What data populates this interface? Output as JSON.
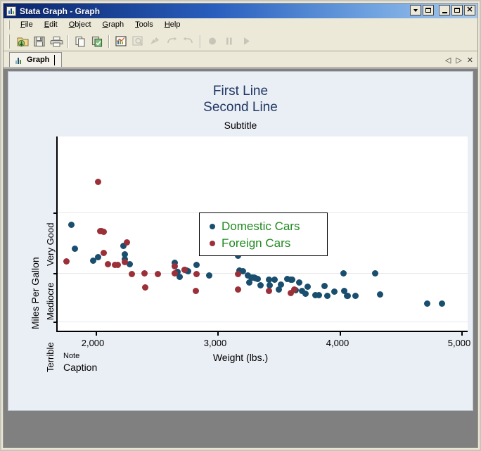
{
  "window": {
    "title": "Stata Graph - Graph",
    "title_icon": "bar-chart-icon",
    "controls": {
      "mdi_caret": "▾",
      "mdi_restore": "restore-icon",
      "minimize": "minimize-icon",
      "maximize": "maximize-icon",
      "close": "✕"
    }
  },
  "menubar": {
    "items": [
      {
        "label": "File",
        "accel": "F"
      },
      {
        "label": "Edit",
        "accel": "E"
      },
      {
        "label": "Object",
        "accel": "O"
      },
      {
        "label": "Graph",
        "accel": "G"
      },
      {
        "label": "Tools",
        "accel": "T"
      },
      {
        "label": "Help",
        "accel": "H"
      }
    ]
  },
  "toolbar": {
    "buttons": [
      {
        "name": "open-icon",
        "enabled": true
      },
      {
        "name": "save-icon",
        "enabled": true
      },
      {
        "name": "print-icon",
        "enabled": true
      },
      {
        "name": "copy-icon",
        "enabled": true
      },
      {
        "name": "paste-icon",
        "enabled": true
      },
      {
        "name": "graph-editor-icon",
        "enabled": true
      },
      {
        "name": "inspector-icon",
        "enabled": false
      },
      {
        "name": "grid-edit-icon",
        "enabled": false
      },
      {
        "name": "undo-icon",
        "enabled": false
      },
      {
        "name": "redo-icon",
        "enabled": false
      },
      {
        "name": "record-icon",
        "enabled": false
      },
      {
        "name": "pause-icon",
        "enabled": false
      },
      {
        "name": "play-icon",
        "enabled": false
      }
    ]
  },
  "tabbar": {
    "tabs": [
      {
        "label": "Graph",
        "icon": "bar-chart-icon",
        "active": true
      }
    ],
    "controls": {
      "prev": "◁",
      "next": "▷",
      "close": "✕"
    }
  },
  "chart_data": {
    "type": "scatter",
    "title": "First Line\nSecond Line",
    "title_lines": [
      "First Line",
      "Second Line"
    ],
    "subtitle": "Subtitle",
    "note": "Note",
    "caption": "Caption",
    "xlabel": "Weight (lbs.)",
    "ylabel": "Miles Per Gallon",
    "xlim": [
      1690,
      5050
    ],
    "ylim": [
      10.5,
      42.5
    ],
    "xticks": [
      2000,
      3000,
      4000,
      5000
    ],
    "xticklabels": [
      "2,000",
      "3,000",
      "4,000",
      "5,000"
    ],
    "yticks": [
      30,
      20,
      12
    ],
    "yticklabels": [
      "Very Good",
      "Mediocre",
      "Terrible"
    ],
    "grid": true,
    "legend_position": "top-center-inside",
    "colors": {
      "domestic": "#1a4e6e",
      "foreign": "#9b3039",
      "legend_text": "#1e8b1e",
      "title": "#1f3864"
    },
    "series": [
      {
        "name": "Domestic Cars",
        "color": "#1a4e6e",
        "points": [
          [
            1800,
            28
          ],
          [
            1830,
            24
          ],
          [
            1980,
            22
          ],
          [
            2020,
            22.6
          ],
          [
            2230,
            24.5
          ],
          [
            2240,
            23.1
          ],
          [
            2240,
            22.3
          ],
          [
            2280,
            21.4
          ],
          [
            2650,
            21.7
          ],
          [
            2670,
            20.2
          ],
          [
            2690,
            19.4
          ],
          [
            2730,
            20.5
          ],
          [
            2750,
            20.4
          ],
          [
            2760,
            20.3
          ],
          [
            2830,
            21.3
          ],
          [
            2930,
            19.6
          ],
          [
            3170,
            22.8
          ],
          [
            3180,
            20.4
          ],
          [
            3210,
            20.3
          ],
          [
            3250,
            19.6
          ],
          [
            3260,
            18.4
          ],
          [
            3280,
            19.2
          ],
          [
            3290,
            19.2
          ],
          [
            3300,
            19.2
          ],
          [
            3310,
            19.1
          ],
          [
            3330,
            19.0
          ],
          [
            3350,
            18.0
          ],
          [
            3420,
            18.9
          ],
          [
            3430,
            18.0
          ],
          [
            3470,
            18.9
          ],
          [
            3500,
            17.3
          ],
          [
            3520,
            18.1
          ],
          [
            3570,
            19.0
          ],
          [
            3600,
            18.9
          ],
          [
            3610,
            18.9
          ],
          [
            3640,
            17.2
          ],
          [
            3670,
            18.4
          ],
          [
            3690,
            17.0
          ],
          [
            3720,
            16.6
          ],
          [
            3740,
            17.8
          ],
          [
            3800,
            16.3
          ],
          [
            3830,
            16.3
          ],
          [
            3880,
            17.9
          ],
          [
            3900,
            16.2
          ],
          [
            3960,
            16.9
          ],
          [
            4030,
            20.0
          ],
          [
            4040,
            17.0
          ],
          [
            4060,
            16.2
          ],
          [
            4070,
            16.2
          ],
          [
            4130,
            16.2
          ],
          [
            4290,
            20.0
          ],
          [
            4330,
            16.5
          ],
          [
            4720,
            15.0
          ],
          [
            4840,
            15.0
          ]
        ]
      },
      {
        "name": "Foreign Cars",
        "color": "#9b3039",
        "points": [
          [
            1760,
            21.9
          ],
          [
            2020,
            35.0
          ],
          [
            2040,
            26.9
          ],
          [
            2050,
            26.9
          ],
          [
            2070,
            26.8
          ],
          [
            2070,
            23.3
          ],
          [
            2100,
            21.5
          ],
          [
            2160,
            21.3
          ],
          [
            2180,
            21.3
          ],
          [
            2240,
            21.8
          ],
          [
            2260,
            25.0
          ],
          [
            2300,
            19.8
          ],
          [
            2400,
            20.0
          ],
          [
            2410,
            17.6
          ],
          [
            2510,
            19.8
          ],
          [
            2650,
            20.0
          ],
          [
            2650,
            21.1
          ],
          [
            2730,
            20.5
          ],
          [
            2820,
            17.0
          ],
          [
            2830,
            19.8
          ],
          [
            3170,
            19.8
          ],
          [
            3170,
            17.3
          ],
          [
            3420,
            17.0
          ],
          [
            3600,
            16.7
          ],
          [
            3630,
            17.3
          ]
        ]
      }
    ]
  }
}
